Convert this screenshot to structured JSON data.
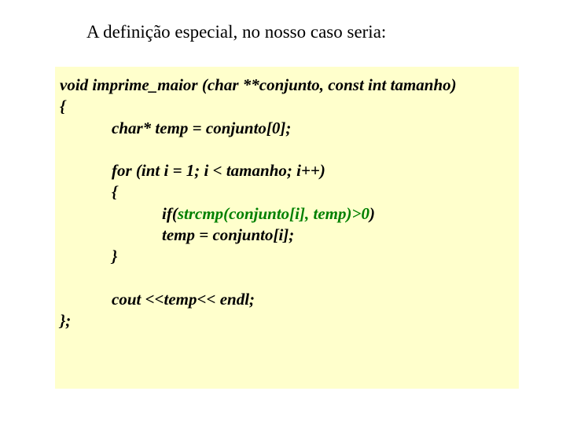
{
  "title": "A definição especial, no nosso caso seria:",
  "code": {
    "sig": "void imprime_maior (char **conjunto, const int tamanho)",
    "ob": "{",
    "decl": "char* temp = conjunto[0];",
    "forh": "for (int i = 1; i < tamanho; i++)",
    "fob": "{",
    "if_pre": "if(",
    "if_cond": "strcmp(conjunto[i], temp)>0",
    "if_post": ")",
    "assign": "temp = conjunto[i];",
    "fcb": "}",
    "cout": "cout <<temp<< endl;",
    "cb": "};"
  }
}
